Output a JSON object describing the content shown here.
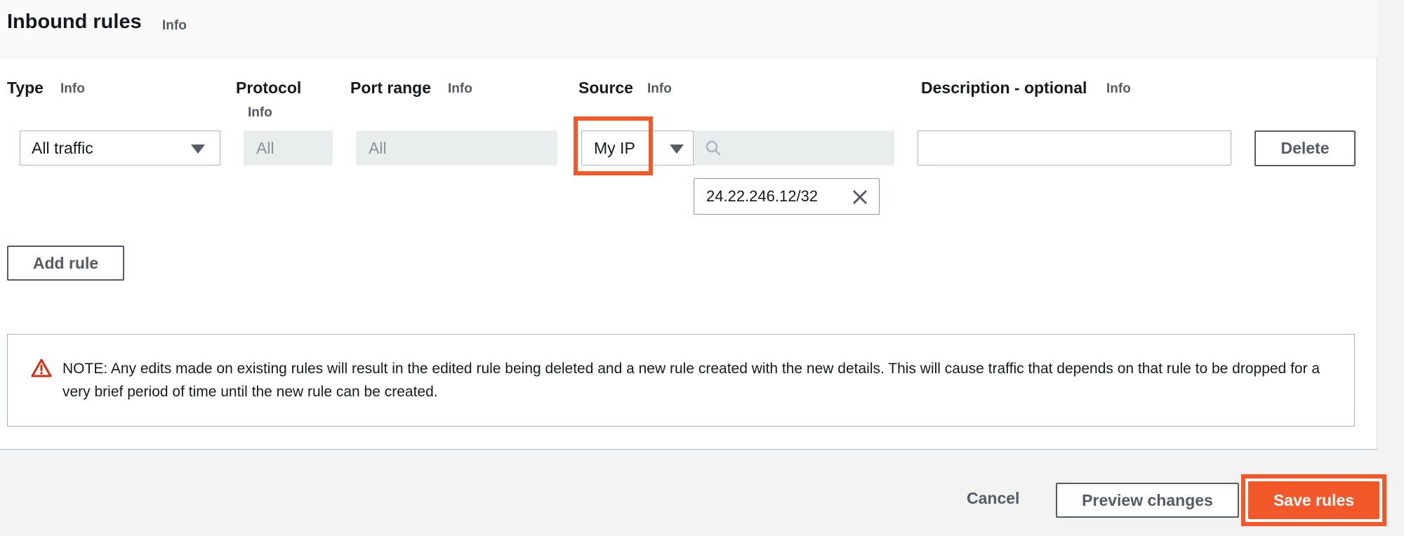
{
  "header": {
    "title": "Inbound rules",
    "info": "Info"
  },
  "columns": {
    "type": {
      "label": "Type",
      "info": "Info"
    },
    "protocol": {
      "label": "Protocol",
      "info": "Info"
    },
    "port_range": {
      "label": "Port range",
      "info": "Info"
    },
    "source": {
      "label": "Source",
      "info": "Info"
    },
    "description": {
      "label": "Description - optional",
      "info": "Info"
    }
  },
  "rule": {
    "type_value": "All traffic",
    "protocol_value": "All",
    "port_range_value": "All",
    "source_value": "My IP",
    "source_search_value": "",
    "source_token": "24.22.246.12/32",
    "description_value": "",
    "delete_label": "Delete"
  },
  "add_rule_label": "Add rule",
  "note": {
    "icon": "warning-icon",
    "text": "NOTE: Any edits made on existing rules will result in the edited rule being deleted and a new rule created with the new details. This will cause traffic that depends on that rule to be dropped for a very brief period of time until the new rule can be created."
  },
  "footer": {
    "cancel_label": "Cancel",
    "preview_label": "Preview changes",
    "save_label": "Save rules"
  },
  "colors": {
    "highlight": "#f2582a",
    "primary": "#ec7211",
    "warning": "#d13212"
  }
}
